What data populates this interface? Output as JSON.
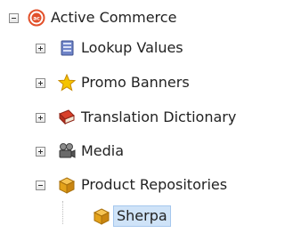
{
  "tree": {
    "root": {
      "label": "Active Commerce",
      "icon": "active-commerce-logo-icon",
      "expanded": true
    },
    "children": [
      {
        "label": "Lookup Values",
        "icon": "database-icon",
        "expanded": false
      },
      {
        "label": "Promo Banners",
        "icon": "star-icon",
        "expanded": false
      },
      {
        "label": "Translation Dictionary",
        "icon": "book-icon",
        "expanded": false
      },
      {
        "label": "Media",
        "icon": "media-camera-icon",
        "expanded": false
      },
      {
        "label": "Product Repositories",
        "icon": "box-icon",
        "expanded": true,
        "children": [
          {
            "label": "Sherpa",
            "icon": "box-icon",
            "selected": true
          }
        ]
      }
    ]
  },
  "colors": {
    "selection_bg": "#cfe3f8",
    "selection_border": "#a5c7ee",
    "logo_red": "#e2502a",
    "star_yellow": "#f5c400",
    "box_orange": "#e3a21a"
  }
}
